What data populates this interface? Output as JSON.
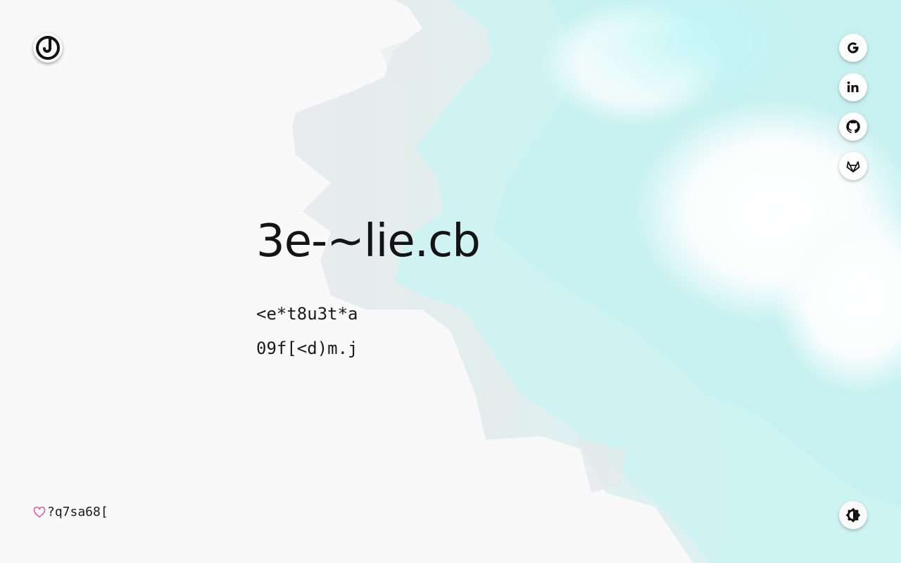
{
  "header": {
    "logo_icon": "j-logo-icon"
  },
  "hero": {
    "title": "3e-~lie.cb",
    "line1": "<e*t8u3t*a",
    "line2": "09f[<d)m.j"
  },
  "social_links": [
    {
      "name": "google",
      "icon": "google-icon"
    },
    {
      "name": "linkedin",
      "icon": "linkedin-icon"
    },
    {
      "name": "github",
      "icon": "github-icon"
    },
    {
      "name": "gitlab",
      "icon": "gitlab-icon"
    }
  ],
  "footer": {
    "text": "?q7sa68[",
    "icon": "heart-icon",
    "icon_color": "#e0609a"
  },
  "theme_toggle": {
    "icon": "brightness-icon"
  },
  "colors": {
    "background": "#f9f9f9",
    "accent_cyan": "#b8f3f3",
    "text": "#141414"
  }
}
